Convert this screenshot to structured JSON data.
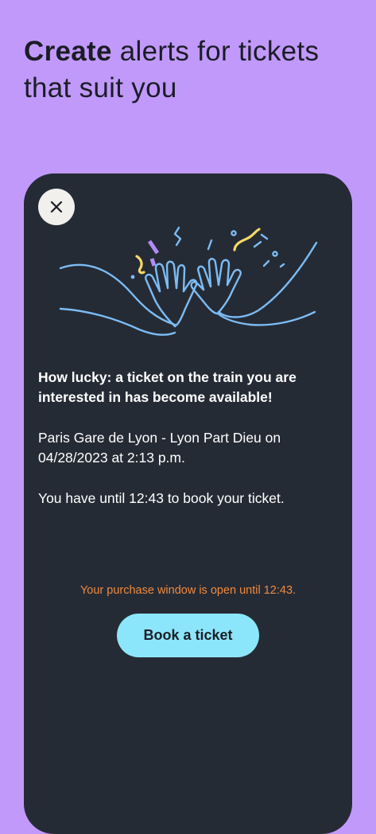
{
  "header": {
    "title_bold": "Create",
    "title_rest": " alerts for tickets that suit you"
  },
  "card": {
    "close_icon": "close-icon",
    "illustration_icon": "high-five-illustration",
    "lead": "How lucky: a ticket on the train you are interested in has become available!",
    "route": "Paris Gare de Lyon - Lyon Part Dieu on 04/28/2023 at 2:13 p.m.",
    "deadline": "You have until 12:43 to book your ticket.",
    "window_note": "Your purchase window is open until 12:43.",
    "book_label": "Book a ticket"
  },
  "colors": {
    "background": "#c199fb",
    "card": "#252b35",
    "accent_button": "#8ce6fb",
    "note": "#ef8a3e",
    "illustration_line": "#7cbcf5",
    "confetti_yellow": "#f5d867",
    "confetti_purple": "#b18cf5"
  }
}
